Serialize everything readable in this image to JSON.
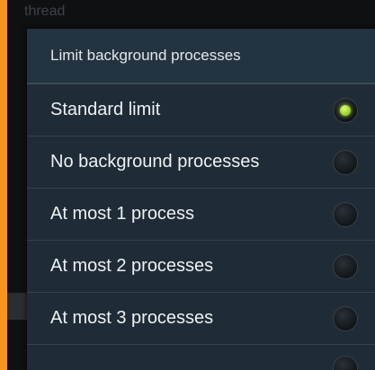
{
  "background": {
    "partial_text": "thread"
  },
  "dialog": {
    "title": "Limit background processes",
    "options": [
      {
        "label": "Standard limit",
        "selected": true
      },
      {
        "label": "No background processes",
        "selected": false
      },
      {
        "label": "At most 1 process",
        "selected": false
      },
      {
        "label": "At most 2 processes",
        "selected": false
      },
      {
        "label": "At most 3 processes",
        "selected": false
      }
    ]
  },
  "colors": {
    "frame": "#f7941d",
    "dialog_bg": "#1f2c37",
    "selected_radio": "#9ed12a"
  }
}
